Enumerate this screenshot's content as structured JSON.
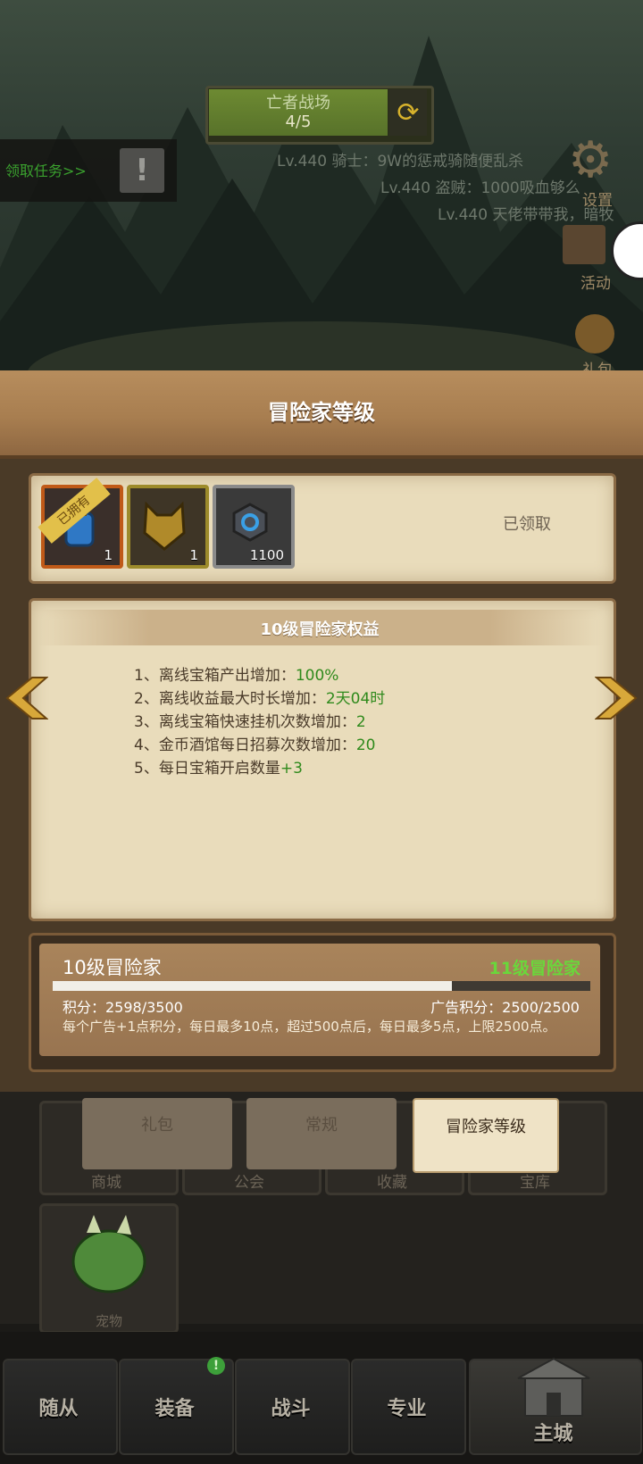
{
  "top": {
    "battle_title": "亡者战场",
    "battle_count": "4/5",
    "task_label": "领取任务>>",
    "task_alert_icon": "!",
    "chat_feed": [
      "Lv.440 骑士：9W的惩戒骑随便乱杀",
      "Lv.440 盗贼：1000吸血够么",
      "Lv.440 天佬带带我，暗牧"
    ],
    "side_menu": {
      "settings_label": "设置",
      "activity_label": "活动",
      "gift_label": "礼包"
    }
  },
  "panel": {
    "title": "冒险家等级",
    "rewards": {
      "items": [
        {
          "icon": "blue-flask-icon",
          "count": "1",
          "tag": "已拥有"
        },
        {
          "icon": "gold-armor-icon",
          "count": "1"
        },
        {
          "icon": "blue-gem-icon",
          "count": "1100"
        }
      ],
      "status": "已领取"
    },
    "benefits": {
      "title": "10级冒险家权益",
      "lines": [
        {
          "prefix": "1、离线宝箱产出增加：",
          "value": "100%"
        },
        {
          "prefix": "2、离线收益最大时长增加：",
          "value": "2天04时"
        },
        {
          "prefix": "3、离线宝箱快速挂机次数增加：",
          "value": "2"
        },
        {
          "prefix": "4、金币酒馆每日招募次数增加：",
          "value": "20"
        },
        {
          "prefix": "5、每日宝箱开启数量",
          "value": "+3"
        }
      ]
    },
    "progress": {
      "current_level": "10级冒险家",
      "next_level": "11级冒险家",
      "points_text": "积分：2598/3500",
      "points_fraction": 0.742,
      "ad_points_text": "广告积分：2500/2500",
      "note": "每个广告+1点积分，每日最多10点，超过500点后，每日最多5点，上限2500点。"
    }
  },
  "lower": {
    "tabs": [
      "礼包",
      "常规",
      "冒险家等级"
    ],
    "active_tab": "冒险家等级",
    "shop_labels": [
      "商城",
      "公会",
      "收藏",
      "宝库"
    ],
    "pet_label": "宠物"
  },
  "nav": {
    "items": [
      "随从",
      "装备",
      "战斗",
      "专业",
      "主城"
    ],
    "badge": "!"
  },
  "colors": {
    "accent_green": "#2f8a1c",
    "next_level_green": "#6ad73b",
    "panel_brown": "#a87e50",
    "parchment": "#e9dcbb"
  }
}
